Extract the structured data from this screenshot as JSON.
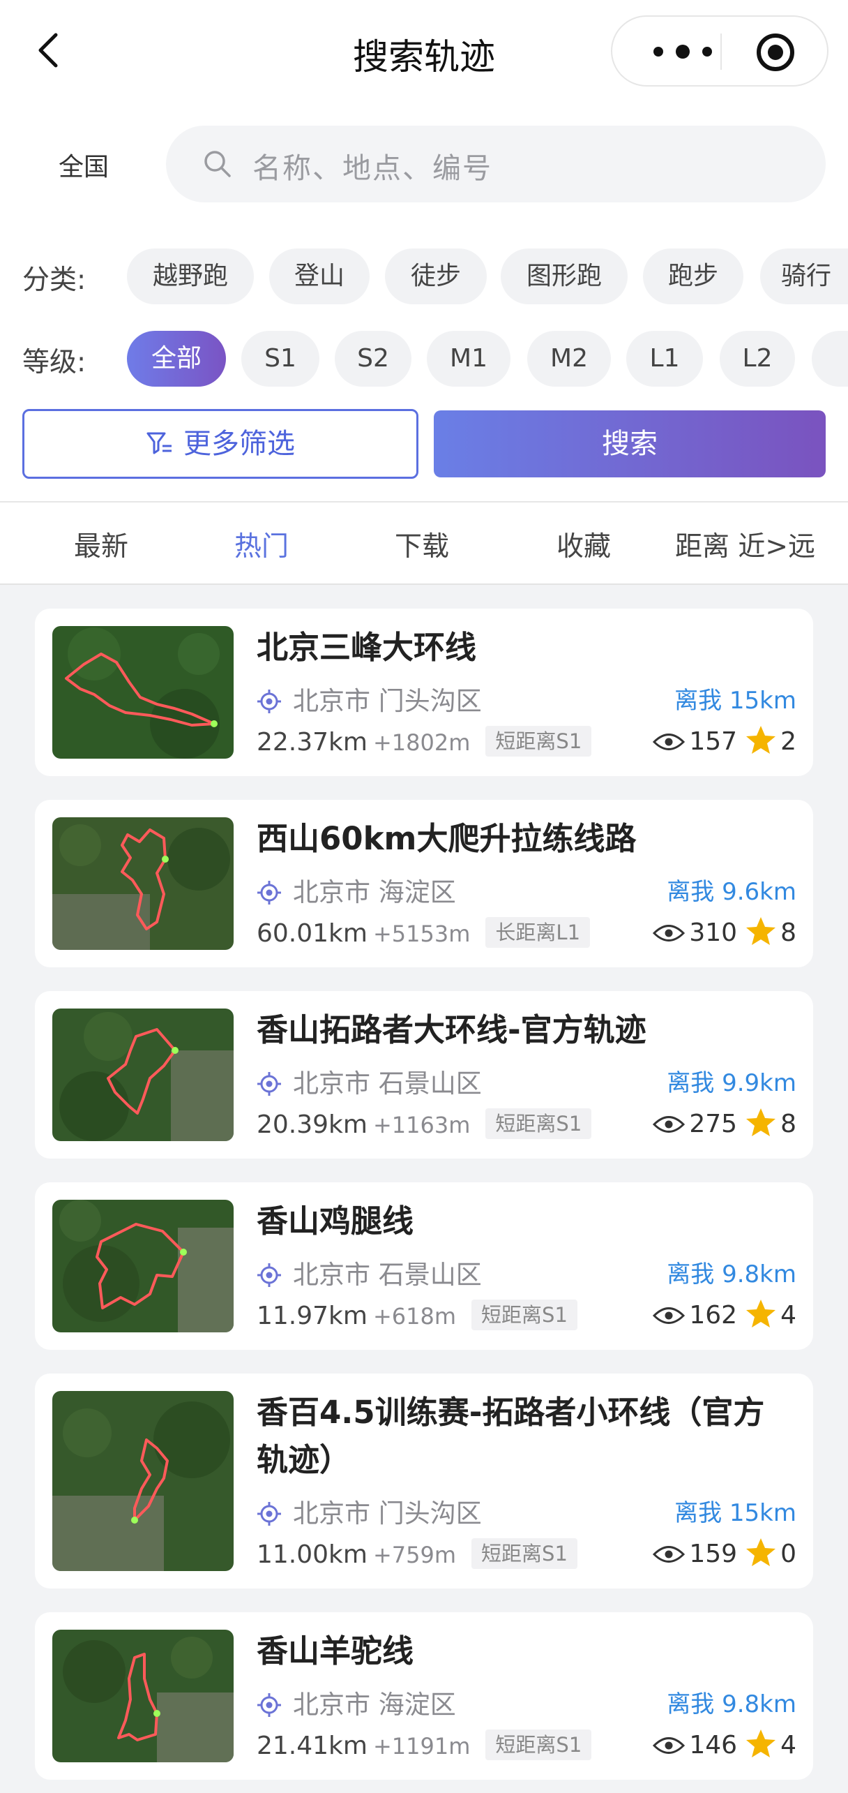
{
  "nav": {
    "title": "搜索轨迹"
  },
  "search": {
    "region": "全国",
    "placeholder": "名称、地点、编号"
  },
  "filters": {
    "category_label": "分类:",
    "categories": [
      "越野跑",
      "登山",
      "徒步",
      "图形跑",
      "跑步",
      "骑行"
    ],
    "level_label": "等级:",
    "levels": [
      "全部",
      "S1",
      "S2",
      "M1",
      "M2",
      "L1",
      "L2"
    ],
    "active_level": "全部",
    "more_label": "更多筛选",
    "search_label": "搜索"
  },
  "sort_tabs": [
    "最新",
    "热门",
    "下载",
    "收藏",
    "距离 近>远"
  ],
  "active_sort": "热门",
  "colors": {
    "accent": "#5a72df",
    "distance": "#3289e0",
    "star": "#f5b400",
    "track": "#ff5a5a"
  },
  "tracks": [
    {
      "title": "北京三峰大环线",
      "location": "北京市 门头沟区",
      "distance": "离我 15km",
      "km": "22.37km",
      "elevation": "+1802m",
      "tag": "短距离S1",
      "views": "157",
      "stars": "2"
    },
    {
      "title": "西山60km大爬升拉练线路",
      "location": "北京市 海淀区",
      "distance": "离我 9.6km",
      "km": "60.01km",
      "elevation": "+5153m",
      "tag": "长距离L1",
      "views": "310",
      "stars": "8"
    },
    {
      "title": "香山拓路者大环线-官方轨迹",
      "location": "北京市 石景山区",
      "distance": "离我 9.9km",
      "km": "20.39km",
      "elevation": "+1163m",
      "tag": "短距离S1",
      "views": "275",
      "stars": "8"
    },
    {
      "title": "香山鸡腿线",
      "location": "北京市 石景山区",
      "distance": "离我 9.8km",
      "km": "11.97km",
      "elevation": "+618m",
      "tag": "短距离S1",
      "views": "162",
      "stars": "4"
    },
    {
      "title": "香百4.5训练赛-拓路者小环线（官方轨迹）",
      "location": "北京市 门头沟区",
      "distance": "离我 15km",
      "km": "11.00km",
      "elevation": "+759m",
      "tag": "短距离S1",
      "views": "159",
      "stars": "0"
    },
    {
      "title": "香山羊驼线",
      "location": "北京市 海淀区",
      "distance": "离我 9.8km",
      "km": "21.41km",
      "elevation": "+1191m",
      "tag": "短距离S1",
      "views": "146",
      "stars": "4"
    }
  ]
}
